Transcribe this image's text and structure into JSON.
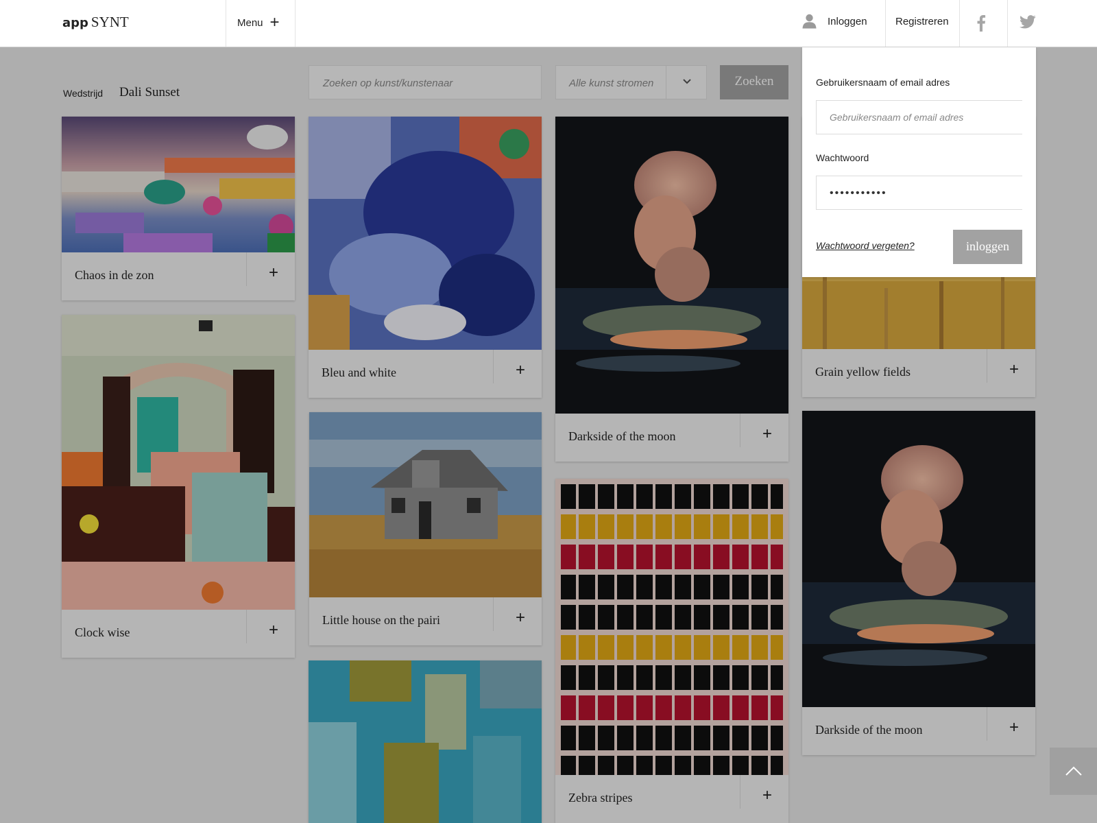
{
  "brand": {
    "part1": "app",
    "part2": "SYNT"
  },
  "header": {
    "menu_label": "Menu",
    "menu_plus": "+",
    "login_label": "Inloggen",
    "register_label": "Registreren"
  },
  "toolbar": {
    "competition_label": "Wedstrijd",
    "competition_value": "Dali Sunset",
    "search_placeholder": "Zoeken op kunst/kunstenaar",
    "select_value": "Alle kunst stromen",
    "search_button": "Zoeken"
  },
  "login_dropdown": {
    "username_label": "Gebruikersnaam of email adres",
    "username_placeholder": "Gebruikersnaam of email adres",
    "password_label": "Wachtwoord",
    "password_value": "•••••••••••",
    "forgot_link": "Wachtwoord vergeten?",
    "submit_label": "inloggen"
  },
  "artworks": [
    {
      "title": "Chaos in de zon",
      "plus": "+"
    },
    {
      "title": "Clock wise",
      "plus": "+"
    },
    {
      "title": "Bleu and white",
      "plus": "+"
    },
    {
      "title": "Little house on the pairi",
      "plus": "+"
    },
    {
      "title": "Darkside of the moon",
      "plus": "+"
    },
    {
      "title": "Zebra stripes",
      "plus": "+"
    },
    {
      "title": "Grain yellow fields",
      "plus": "+"
    },
    {
      "title": "Darkside of the moon",
      "plus": "+"
    }
  ],
  "colors": {
    "overlay": "rgba(0,0,0,0.25)",
    "button_gray": "#a2a2a2",
    "card_bar": "#f2f2f2"
  }
}
